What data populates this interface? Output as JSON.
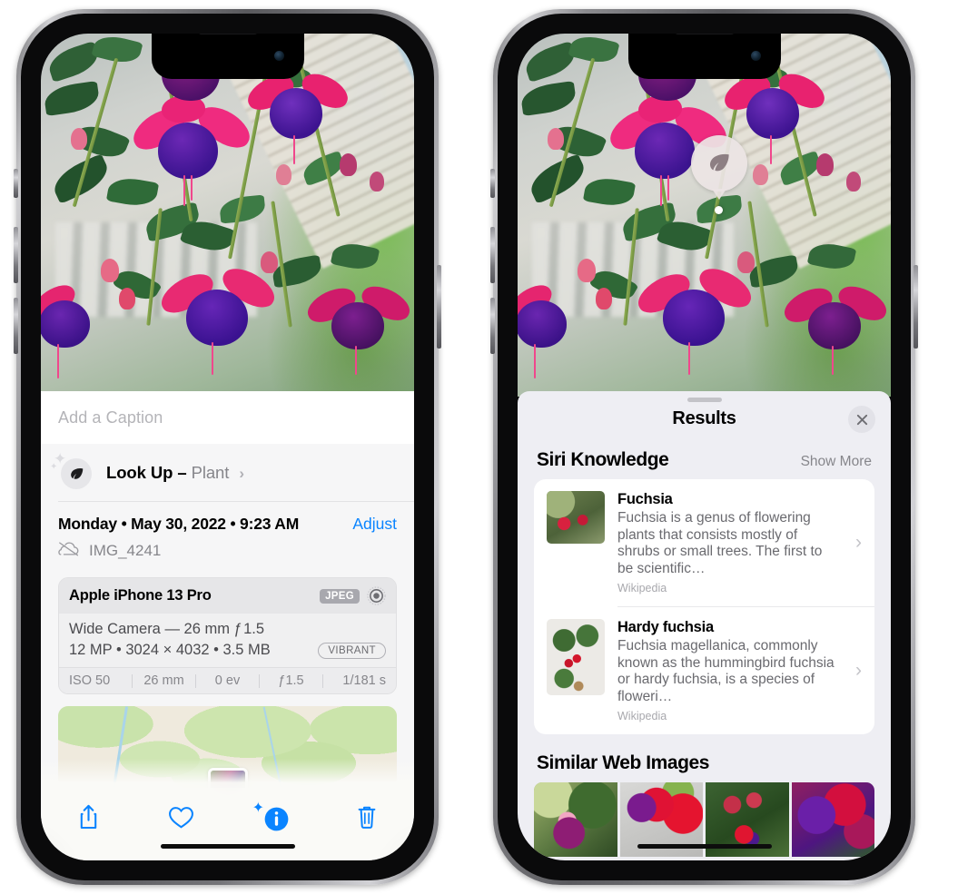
{
  "left_phone": {
    "caption_placeholder": "Add a Caption",
    "lookup": {
      "label": "Look Up",
      "dash": "–",
      "object": "Plant",
      "chevron": "›",
      "icon": "leaf-icon"
    },
    "meta": {
      "date": "Monday • May 30, 2022 • 9:23 AM",
      "adjust_label": "Adjust",
      "filename": "IMG_4241",
      "cloud_icon": "icloud-slash-icon"
    },
    "exif": {
      "device": "Apple iPhone 13 Pro",
      "format_badge": "JPEG",
      "raw_icon": "raw-ring-icon",
      "lens_line": "Wide Camera — 26 mm ƒ 1.5",
      "size_line": "12 MP • 3024 × 4032 • 3.5 MB",
      "style_badge": "VIBRANT",
      "stats": [
        "ISO 50",
        "26 mm",
        "0 ev",
        "ƒ1.5",
        "1/181 s"
      ]
    },
    "toolbar": [
      {
        "name": "share-button",
        "icon": "share-icon"
      },
      {
        "name": "favorite-button",
        "icon": "heart-icon"
      },
      {
        "name": "info-button",
        "icon": "info-sparkle-icon"
      },
      {
        "name": "delete-button",
        "icon": "trash-icon"
      }
    ],
    "accent_color": "#0a84ff"
  },
  "right_phone": {
    "badge": {
      "icon": "leaf-icon"
    },
    "sheet": {
      "title": "Results",
      "close_icon": "close-icon",
      "sections": [
        {
          "title": "Siri Knowledge",
          "action": "Show More"
        },
        {
          "title": "Similar Web Images",
          "action": ""
        }
      ]
    },
    "knowledge": [
      {
        "title": "Fuchsia",
        "desc": "Fuchsia is a genus of flowering plants that consists mostly of shrubs or small trees. The first to be scientific…",
        "source": "Wikipedia",
        "chevron": "›"
      },
      {
        "title": "Hardy fuchsia",
        "desc": "Fuchsia magellanica, commonly known as the hummingbird fuchsia or hardy fuchsia, is a species of floweri…",
        "source": "Wikipedia",
        "chevron": "›"
      }
    ],
    "similar_images_count": 4,
    "sheet_bg": "#eeeef3"
  }
}
